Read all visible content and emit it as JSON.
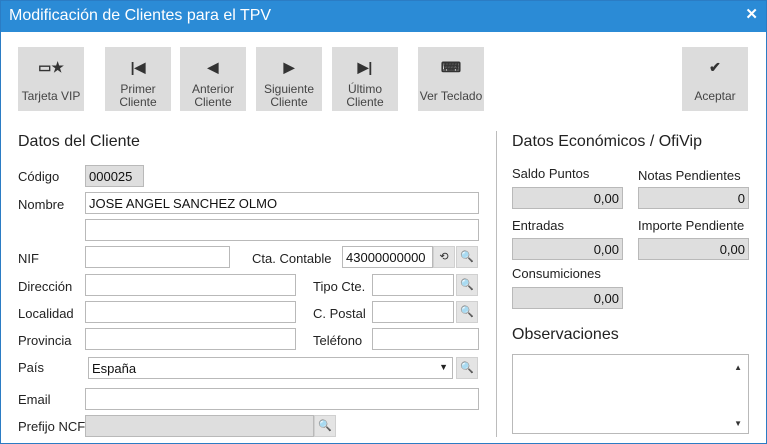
{
  "window": {
    "title": "Modificación de Clientes para el TPV",
    "close_glyph": "✕"
  },
  "toolbar": {
    "tarjeta_vip": "Tarjeta VIP",
    "primer_1": "Primer",
    "primer_2": "Cliente",
    "anterior_1": "Anterior",
    "anterior_2": "Cliente",
    "siguiente_1": "Siguiente",
    "siguiente_2": "Cliente",
    "ultimo_1": "Último",
    "ultimo_2": "Cliente",
    "ver_teclado": "Ver Teclado",
    "aceptar": "Aceptar"
  },
  "cliente": {
    "header": "Datos del Cliente",
    "codigo_label": "Código",
    "codigo_value": "000025",
    "nombre_label": "Nombre",
    "nombre_value": "JOSE ANGEL SANCHEZ OLMO",
    "nombre2_value": "",
    "nif_label": "NIF",
    "nif_value": "",
    "cta_label": "Cta. Contable",
    "cta_value": "43000000000",
    "direccion_label": "Dirección",
    "direccion_value": "",
    "tipo_label": "Tipo Cte.",
    "tipo_value": "",
    "localidad_label": "Localidad",
    "localidad_value": "",
    "cpostal_label": "C. Postal",
    "cpostal_value": "",
    "provincia_label": "Provincia",
    "provincia_value": "",
    "telefono_label": "Teléfono",
    "telefono_value": "",
    "pais_label": "País",
    "pais_value": "España",
    "email_label": "Email",
    "email_value": "",
    "prefijo_label": "Prefijo NCF",
    "prefijo_value": ""
  },
  "economicos": {
    "header": "Datos Económicos  / OfiVip",
    "saldo_label": "Saldo Puntos",
    "saldo_value": "0,00",
    "notas_label": "Notas Pendientes",
    "notas_value": "0",
    "entradas_label": "Entradas",
    "entradas_value": "0,00",
    "importe_label": "Importe Pendiente",
    "importe_value": "0,00",
    "consumiciones_label": "Consumiciones",
    "consumiciones_value": "0,00",
    "observaciones_label": "Observaciones",
    "observaciones_value": ""
  },
  "icons": {
    "vip": "▭★",
    "first": "|◀",
    "prev": "◀",
    "next": "▶",
    "last": "▶|",
    "keyboard": "⌨",
    "accept": "✔",
    "search": "🔍",
    "calc": "⟲",
    "dropdown": "▼",
    "scroll_up": "▲",
    "scroll_down": "▼"
  }
}
